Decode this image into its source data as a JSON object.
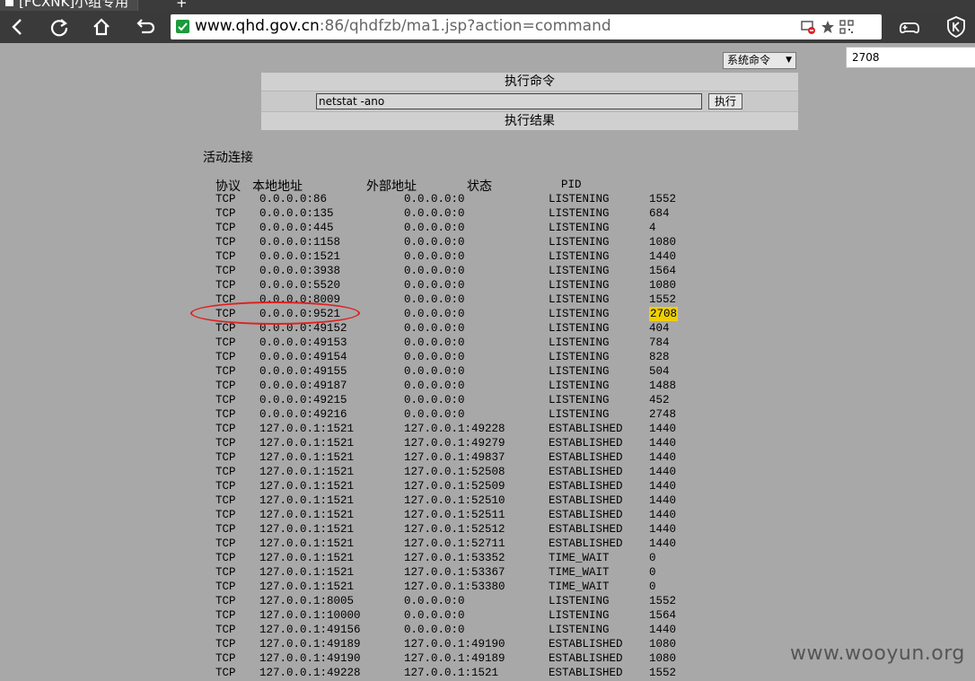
{
  "browser": {
    "tab_title": "[FCXNK]小组专用",
    "new_tab": "+",
    "url_host": "www.qhd.gov.cn",
    "url_rest": ":86/qhdfzb/ma1.jsp?action=command",
    "side_search_value": "2708"
  },
  "page": {
    "command_select": "系统命令",
    "exec_header": "执行命令",
    "command_input": "netstat -ano",
    "exec_button": "执行",
    "result_header": "执行结果",
    "section_title": "活动连接",
    "columns": [
      "协议",
      "本地地址",
      "外部地址",
      "状态",
      "PID"
    ],
    "rows": [
      [
        "TCP",
        "0.0.0.0:86",
        "0.0.0.0:0",
        "LISTENING",
        "1552"
      ],
      [
        "TCP",
        "0.0.0.0:135",
        "0.0.0.0:0",
        "LISTENING",
        "684"
      ],
      [
        "TCP",
        "0.0.0.0:445",
        "0.0.0.0:0",
        "LISTENING",
        "4"
      ],
      [
        "TCP",
        "0.0.0.0:1158",
        "0.0.0.0:0",
        "LISTENING",
        "1080"
      ],
      [
        "TCP",
        "0.0.0.0:1521",
        "0.0.0.0:0",
        "LISTENING",
        "1440"
      ],
      [
        "TCP",
        "0.0.0.0:3938",
        "0.0.0.0:0",
        "LISTENING",
        "1564"
      ],
      [
        "TCP",
        "0.0.0.0:5520",
        "0.0.0.0:0",
        "LISTENING",
        "1080"
      ],
      [
        "TCP",
        "0.0.0.0:8009",
        "0.0.0.0:0",
        "LISTENING",
        "1552"
      ],
      [
        "TCP",
        "0.0.0.0:9521",
        "0.0.0.0:0",
        "LISTENING",
        "2708"
      ],
      [
        "TCP",
        "0.0.0.0:49152",
        "0.0.0.0:0",
        "LISTENING",
        "404"
      ],
      [
        "TCP",
        "0.0.0.0:49153",
        "0.0.0.0:0",
        "LISTENING",
        "784"
      ],
      [
        "TCP",
        "0.0.0.0:49154",
        "0.0.0.0:0",
        "LISTENING",
        "828"
      ],
      [
        "TCP",
        "0.0.0.0:49155",
        "0.0.0.0:0",
        "LISTENING",
        "504"
      ],
      [
        "TCP",
        "0.0.0.0:49187",
        "0.0.0.0:0",
        "LISTENING",
        "1488"
      ],
      [
        "TCP",
        "0.0.0.0:49215",
        "0.0.0.0:0",
        "LISTENING",
        "452"
      ],
      [
        "TCP",
        "0.0.0.0:49216",
        "0.0.0.0:0",
        "LISTENING",
        "2748"
      ],
      [
        "TCP",
        "127.0.0.1:1521",
        "127.0.0.1:49228",
        "ESTABLISHED",
        "1440"
      ],
      [
        "TCP",
        "127.0.0.1:1521",
        "127.0.0.1:49279",
        "ESTABLISHED",
        "1440"
      ],
      [
        "TCP",
        "127.0.0.1:1521",
        "127.0.0.1:49837",
        "ESTABLISHED",
        "1440"
      ],
      [
        "TCP",
        "127.0.0.1:1521",
        "127.0.0.1:52508",
        "ESTABLISHED",
        "1440"
      ],
      [
        "TCP",
        "127.0.0.1:1521",
        "127.0.0.1:52509",
        "ESTABLISHED",
        "1440"
      ],
      [
        "TCP",
        "127.0.0.1:1521",
        "127.0.0.1:52510",
        "ESTABLISHED",
        "1440"
      ],
      [
        "TCP",
        "127.0.0.1:1521",
        "127.0.0.1:52511",
        "ESTABLISHED",
        "1440"
      ],
      [
        "TCP",
        "127.0.0.1:1521",
        "127.0.0.1:52512",
        "ESTABLISHED",
        "1440"
      ],
      [
        "TCP",
        "127.0.0.1:1521",
        "127.0.0.1:52711",
        "ESTABLISHED",
        "1440"
      ],
      [
        "TCP",
        "127.0.0.1:1521",
        "127.0.0.1:53352",
        "TIME_WAIT",
        "0"
      ],
      [
        "TCP",
        "127.0.0.1:1521",
        "127.0.0.1:53367",
        "TIME_WAIT",
        "0"
      ],
      [
        "TCP",
        "127.0.0.1:1521",
        "127.0.0.1:53380",
        "TIME_WAIT",
        "0"
      ],
      [
        "TCP",
        "127.0.0.1:8005",
        "0.0.0.0:0",
        "LISTENING",
        "1552"
      ],
      [
        "TCP",
        "127.0.0.1:10000",
        "0.0.0.0:0",
        "LISTENING",
        "1564"
      ],
      [
        "TCP",
        "127.0.0.1:49156",
        "0.0.0.0:0",
        "LISTENING",
        "1440"
      ],
      [
        "TCP",
        "127.0.0.1:49189",
        "127.0.0.1:49190",
        "ESTABLISHED",
        "1080"
      ],
      [
        "TCP",
        "127.0.0.1:49190",
        "127.0.0.1:49189",
        "ESTABLISHED",
        "1080"
      ],
      [
        "TCP",
        "127.0.0.1:49228",
        "127.0.0.1:1521",
        "ESTABLISHED",
        "1552"
      ]
    ],
    "highlighted_row": 8,
    "highlight_color": "#f0d000",
    "circle_color": "#e02020"
  },
  "watermark": "www.wooyun.org"
}
